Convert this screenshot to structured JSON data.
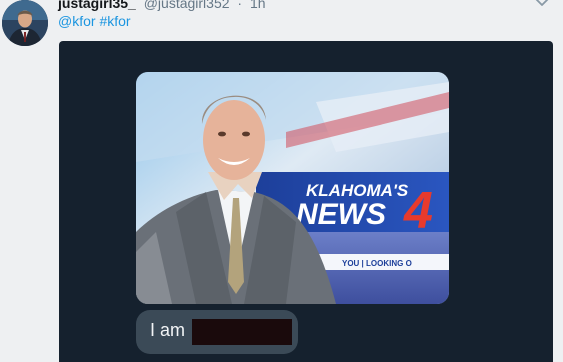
{
  "tweet": {
    "display_name": "justagirl35_",
    "handle": "@justagirl352",
    "separator": "·",
    "time": "1h",
    "hashtags": "@kfor #kfor",
    "caret_icon": "chevron-down-icon",
    "avatar_icon": "avatar"
  },
  "media": {
    "type": "screenshot-of-chat",
    "photo": {
      "logo_top": "KLAHOMA'S",
      "logo_bottom": "NEWS",
      "logo_number": "4",
      "ticker": "YOU | LOOKING O"
    },
    "bubble": {
      "text": "I am",
      "redacted": true
    }
  },
  "colors": {
    "link": "#1b95e0",
    "media_bg": "#15212e",
    "bubble_bg": "#3b4a57",
    "redaction": "#1a0a0c"
  }
}
